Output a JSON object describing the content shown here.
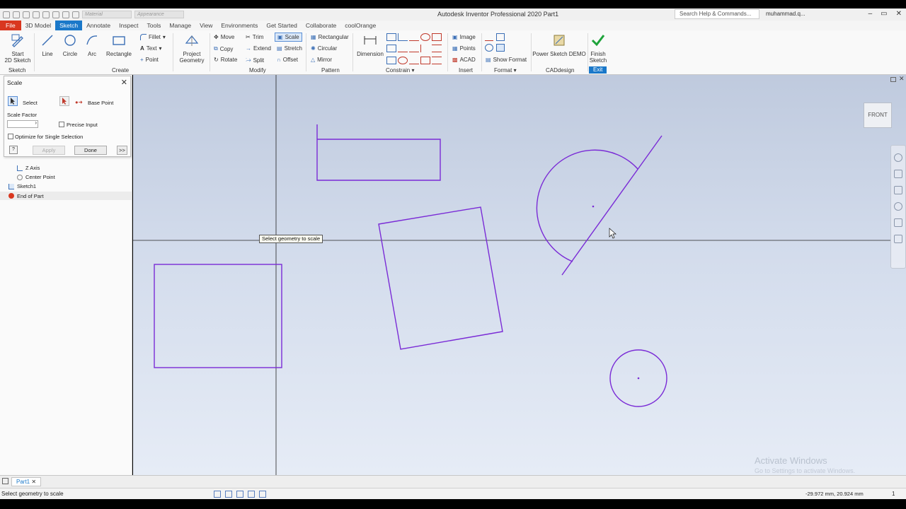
{
  "app": {
    "title": "Autodesk Inventor Professional 2020   Part1",
    "search_placeholder": "Search Help & Commands...",
    "user": "muhammad.q...",
    "qat_material": "Material",
    "qat_appearance": "Appearance"
  },
  "tabs": [
    "File",
    "3D Model",
    "Sketch",
    "Annotate",
    "Inspect",
    "Tools",
    "Manage",
    "View",
    "Environments",
    "Get Started",
    "Collaborate",
    "coolOrange"
  ],
  "active_tab": "Sketch",
  "ribbon": {
    "sketch_group": {
      "start_line1": "Start",
      "start_line2": "2D Sketch",
      "label": "Sketch"
    },
    "create_group": {
      "line": "Line",
      "circle": "Circle",
      "arc": "Arc",
      "rectangle": "Rectangle",
      "fillet": "Fillet",
      "text": "Text",
      "point": "Point",
      "label": "Create"
    },
    "project": {
      "line1": "Project",
      "line2": "Geometry"
    },
    "modify_group": {
      "move": "Move",
      "copy": "Copy",
      "rotate": "Rotate",
      "trim": "Trim",
      "extend": "Extend",
      "split": "Split",
      "scale": "Scale",
      "stretch": "Stretch",
      "offset": "Offset",
      "label": "Modify"
    },
    "pattern_group": {
      "rectangular": "Rectangular",
      "circular": "Circular",
      "mirror": "Mirror",
      "label": "Pattern"
    },
    "constrain_group": {
      "dimension": "Dimension",
      "label": "Constrain"
    },
    "insert_group": {
      "image": "Image",
      "points": "Points",
      "acad": "ACAD",
      "label": "Insert"
    },
    "format_group": {
      "show_format": "Show Format",
      "label": "Format"
    },
    "cadesign_group": {
      "power_sketch": "Power Sketch DEMO",
      "label": "CADdesign"
    },
    "exit_group": {
      "finish_line1": "Finish",
      "finish_line2": "Sketch",
      "label": "Exit"
    }
  },
  "scale_dialog": {
    "title": "Scale",
    "select_label": "Select",
    "base_point_label": "Base Point",
    "scale_factor_label": "Scale Factor",
    "scale_factor_value": "",
    "precise_input_label": "Precise Input",
    "optimize_label": "Optimize for Single Selection",
    "apply_label": "Apply",
    "done_label": "Done",
    "more_label": ">>",
    "help_label": "?"
  },
  "browser_tree": [
    {
      "label": "Z Axis",
      "indent": 2
    },
    {
      "label": "Center Point",
      "indent": 2
    },
    {
      "label": "Sketch1",
      "indent": 1
    },
    {
      "label": "End of Part",
      "indent": 1
    }
  ],
  "canvas": {
    "tooltip": "Select geometry to scale",
    "viewcube_label": "FRONT",
    "sketch_color": "#7a2bd6",
    "watermark_line1": "Activate Windows",
    "watermark_line2": "Go to Settings to activate Windows."
  },
  "doc_tab": "Part1",
  "status": {
    "message": "Select geometry to scale",
    "coords": "-29.972 mm, 20.924 mm",
    "page": "1"
  }
}
